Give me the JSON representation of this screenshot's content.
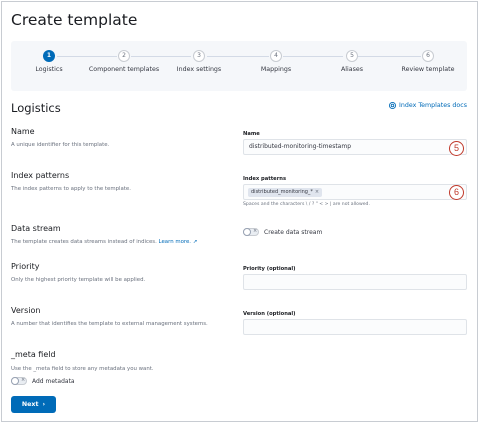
{
  "page": {
    "title": "Create template"
  },
  "steps": [
    {
      "number": "1",
      "label": "Logistics",
      "state": "current"
    },
    {
      "number": "2",
      "label": "Component templates",
      "state": "todo"
    },
    {
      "number": "3",
      "label": "Index settings",
      "state": "todo"
    },
    {
      "number": "4",
      "label": "Mappings",
      "state": "todo"
    },
    {
      "number": "5",
      "label": "Aliases",
      "state": "todo"
    },
    {
      "number": "6",
      "label": "Review template",
      "state": "todo"
    }
  ],
  "section": {
    "title": "Logistics",
    "docs_link": "Index Templates docs",
    "docs_icon": "help-circle-icon"
  },
  "name": {
    "title": "Name",
    "description": "A unique identifier for this template.",
    "field_label": "Name",
    "value": "distributed-monitoring-timestamp",
    "marker": "5"
  },
  "index_patterns": {
    "title": "Index patterns",
    "description": "The index patterns to apply to the template.",
    "field_label": "Index patterns",
    "pill": "distributed_monitoring_*",
    "help": "Spaces and the characters \\ / ? \" < > | are not allowed.",
    "marker": "6"
  },
  "data_stream": {
    "title": "Data stream",
    "description": "The template creates data streams instead of indices.",
    "learn_more": "Learn more.",
    "switch_label": "Create data stream",
    "enabled": false
  },
  "priority": {
    "title": "Priority",
    "description": "Only the highest priority template will be applied.",
    "field_label": "Priority (optional)",
    "value": ""
  },
  "version": {
    "title": "Version",
    "description": "A number that identifies the template to external management systems.",
    "field_label": "Version (optional)",
    "value": ""
  },
  "meta": {
    "title": "_meta field",
    "description": "Use the _meta field to store any metadata you want.",
    "switch_label": "Add metadata",
    "enabled": false
  },
  "footer": {
    "next_label": "Next"
  },
  "colors": {
    "accent": "#006bb8",
    "marker": "#c0392b"
  }
}
